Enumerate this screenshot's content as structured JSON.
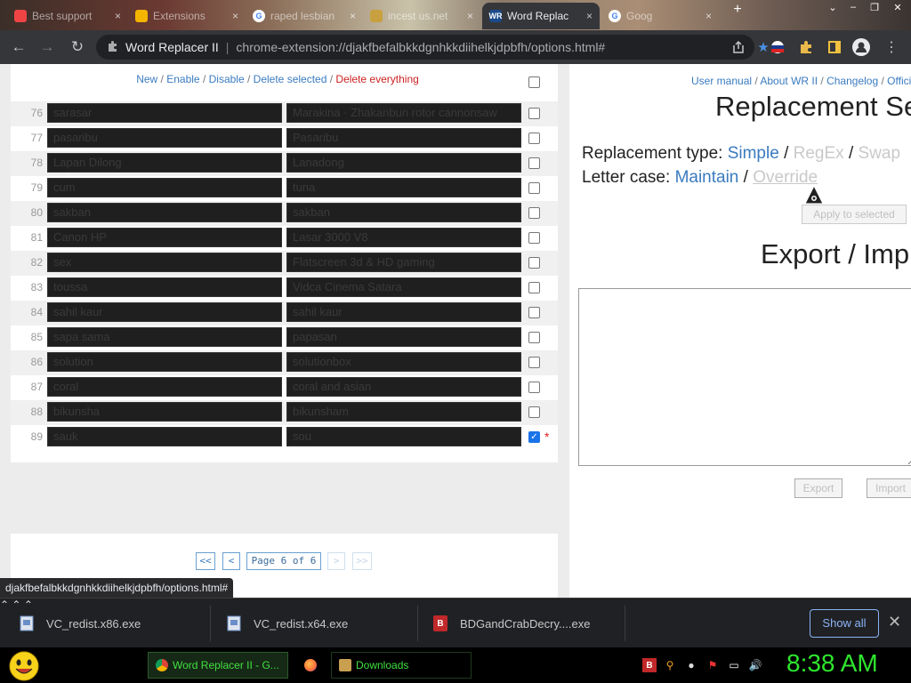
{
  "browser": {
    "tabs": [
      {
        "title": "Best support",
        "favicon_color": "#e44"
      },
      {
        "title": "Extensions",
        "favicon_color": "#f4b400"
      },
      {
        "title": "raped lesbian",
        "favicon_color": "#4285f4"
      },
      {
        "title": "incest us.net",
        "favicon_color": "#c8a040"
      },
      {
        "title": "Word Replac",
        "favicon_text": "WR",
        "favicon_color": "#1a4a8a",
        "active": true
      },
      {
        "title": "Goog",
        "favicon_color": "#4285f4"
      }
    ],
    "tab_close_glyph": "×",
    "new_tab_glyph": "+",
    "window_controls": {
      "menu": "⌄",
      "minimize": "–",
      "restore": "❐",
      "close": "✕"
    },
    "nav": {
      "back": "←",
      "forward": "→",
      "reload": "↻"
    },
    "site_name": "Word Replacer II",
    "url": "chrome-extension://djakfbefalbkkdgnhkkdiihelkjdpbfh/options.html#"
  },
  "left": {
    "actions": {
      "new": "New",
      "enable": "Enable",
      "disable": "Disable",
      "delete_selected": "Delete selected",
      "delete_everything": "Delete everything",
      "sep": " / "
    },
    "rows": [
      {
        "num": "76",
        "from": "sarasar",
        "to": "Marakina · Zhakanbun rotor cannonsaw",
        "checked": false
      },
      {
        "num": "77",
        "from": "pasaribu",
        "to": "Pasaribu",
        "checked": false
      },
      {
        "num": "78",
        "from": "Lapan Dilong",
        "to": "Lanadong",
        "checked": false
      },
      {
        "num": "79",
        "from": "cum",
        "to": "tuna",
        "checked": false
      },
      {
        "num": "80",
        "from": "sakban",
        "to": "sakban",
        "checked": false
      },
      {
        "num": "81",
        "from": "Canon HP",
        "to": "Lasar 3000 V8",
        "checked": false
      },
      {
        "num": "82",
        "from": "sex",
        "to": "Flatscreen 3d & HD gaming",
        "checked": false
      },
      {
        "num": "83",
        "from": "toussa",
        "to": "Vidca Cinema Satara",
        "checked": false
      },
      {
        "num": "84",
        "from": "sahil kaur",
        "to": "sahil kaur",
        "checked": false
      },
      {
        "num": "85",
        "from": "sapa sama",
        "to": "papasan",
        "checked": false
      },
      {
        "num": "86",
        "from": "solution",
        "to": "solutionbox",
        "checked": false
      },
      {
        "num": "87",
        "from": "coral",
        "to": "coral and asian",
        "checked": false
      },
      {
        "num": "88",
        "from": "bikunsha",
        "to": "bikunsham",
        "checked": false
      },
      {
        "num": "89",
        "from": "sauk",
        "to": "sou",
        "checked": true
      }
    ],
    "checkmark": "✓",
    "asterisk": "*",
    "pager": {
      "first": "<<",
      "prev": "<",
      "page_text": "Page 6 of 6",
      "next": ">",
      "last": ">>"
    }
  },
  "right": {
    "links": {
      "manual": "User manual",
      "about": "About WR II",
      "changelog": "Changelog",
      "official": "Offici",
      "sep": " / "
    },
    "settings_title": "Replacement Se",
    "replacement_type": {
      "label": "Replacement type:",
      "simple": "Simple",
      "regex": "RegEx",
      "swap": "Swap"
    },
    "letter_case": {
      "label": "Letter case:",
      "maintain": "Maintain",
      "override": "Override"
    },
    "apply_button": "Apply to selected",
    "export_title": "Export / Imp",
    "export_button": "Export",
    "import_button": "Import"
  },
  "status_url": "djakfbefalbkkdgnhkkdiihelkjdpbfh/options.html#",
  "downloads": [
    {
      "name": "VC_redist.x86.exe",
      "icon_color": "#6a8fc8"
    },
    {
      "name": "VC_redist.x64.exe",
      "icon_color": "#6a8fc8"
    },
    {
      "name": "BDGandCrabDecry....exe",
      "icon_color": "#c0282a",
      "icon_text": "B"
    }
  ],
  "downloads_chevron": "⌃",
  "show_all": "Show all",
  "downloads_close": "✕",
  "taskbar": {
    "tasks": [
      {
        "label": "Word Replacer II - G...",
        "icon_color": "#4285f4",
        "active": true
      },
      {
        "label": "",
        "icon_color": "#ff7139"
      },
      {
        "label": "Downloads",
        "icon_color": "#caa050"
      }
    ],
    "tray_icons": [
      "B",
      "⚲",
      "●",
      "⚑",
      "▭",
      "🔊"
    ],
    "clock": "8:38 AM"
  }
}
